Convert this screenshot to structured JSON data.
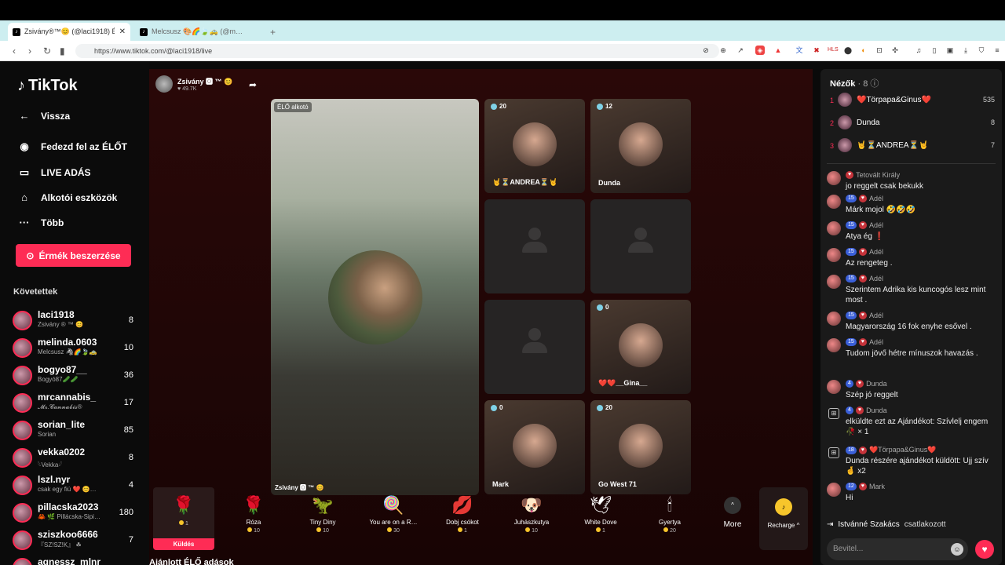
{
  "browser": {
    "tabs": [
      {
        "label": "Zsivány®™😊 (@laci1918) Él…",
        "close": "✕"
      },
      {
        "label": "Melcsusz 🎨🌈🍃🚕 (@m…",
        "close": ""
      }
    ],
    "new_tab": "+",
    "url": "https://www.tiktok.com/@laci1918/live"
  },
  "sidebar": {
    "logo": "TikTok",
    "menu": [
      {
        "label": "Vissza",
        "icon": "←"
      },
      {
        "label": "Fedezd fel az ÉLŐT",
        "icon": "◉"
      },
      {
        "label": "LIVE ADÁS",
        "icon": "▭"
      },
      {
        "label": "Alkotói eszközök",
        "icon": "⌂"
      },
      {
        "label": "Több",
        "icon": "···"
      }
    ],
    "coins_button": "Érmék beszerzése",
    "following_title": "Követettek",
    "following": [
      {
        "name": "laci1918",
        "sub": "Zsivány ® ™ 😊",
        "count": "8"
      },
      {
        "name": "melinda.0603",
        "sub": "Melcsusz 🦓🌈🍃🚕",
        "count": "10"
      },
      {
        "name": "bogyo87__",
        "sub": "Bogyó87🥒🥒",
        "count": "36"
      },
      {
        "name": "mrcannabis_",
        "sub": "𝓜𝓻.𝓒𝓪𝓷𝓷𝓪𝓫𝓲𝓼®",
        "count": "17"
      },
      {
        "name": "sorian_lite",
        "sub": "Sorian",
        "count": "85"
      },
      {
        "name": "vekka0202",
        "sub": "𓆩Vekka𓆪",
        "count": "8"
      },
      {
        "name": "lszl.nyr",
        "sub": "csak egy fiú ❤️ 😊…",
        "count": "4"
      },
      {
        "name": "pillacska2023",
        "sub": "🦀 🌿 Pillácska-Sipi…",
        "count": "180"
      },
      {
        "name": "sziszkoo6666",
        "sub": "『SZ!SZ!K』 ☘",
        "count": "7"
      },
      {
        "name": "agnessz_mlnr",
        "sub": "",
        "count": ""
      }
    ]
  },
  "stage": {
    "host_name": "Zsivány 🅾 ™ 😊",
    "host_likes": "♥ 49.7K",
    "main_tag": "ÉLŐ alkotó",
    "main_caption": "Zsivány 🅾 ™ 😊",
    "cells": [
      {
        "count": "20",
        "name": "🤘⏳ANDREA⏳🤘"
      },
      {
        "count": "12",
        "name": "Dunda"
      },
      {
        "count": "",
        "name": ""
      },
      {
        "count": "",
        "name": ""
      },
      {
        "count": "",
        "name": ""
      },
      {
        "count": "0",
        "name": "❤️❤️__Gina__"
      },
      {
        "count": "0",
        "name": "Mark"
      },
      {
        "count": "20",
        "name": "Go West 71"
      }
    ]
  },
  "gifts": {
    "items": [
      {
        "name": "",
        "price": "1",
        "icon": "🌹",
        "action": "Küldés"
      },
      {
        "name": "Róza",
        "price": "10",
        "icon": "🌹"
      },
      {
        "name": "Tiny Diny",
        "price": "10",
        "icon": "🦖"
      },
      {
        "name": "You are on a R…",
        "price": "30",
        "icon": "🍭"
      },
      {
        "name": "Dobj csókot",
        "price": "1",
        "icon": "💋"
      },
      {
        "name": "Juhászkutya",
        "price": "10",
        "icon": "🐶"
      },
      {
        "name": "White Dove",
        "price": "1",
        "icon": "🕊"
      },
      {
        "name": "Gyertya",
        "price": "20",
        "icon": "🕯"
      }
    ],
    "more": "More",
    "more_icon": "^",
    "recharge": "Recharge ^"
  },
  "recent_title": "Ajánlott ÉLŐ adások",
  "chat": {
    "title": "Nézők",
    "viewer_count": "· 8",
    "ranking": [
      {
        "rank": "1",
        "name": "❤️Törpapa&Ginus❤️",
        "value": "535"
      },
      {
        "rank": "2",
        "name": "Dunda",
        "value": "8"
      },
      {
        "rank": "3",
        "name": "🤘⏳ANDREA⏳🤘",
        "value": "7"
      }
    ],
    "messages": [
      {
        "user": "Tetovált Király",
        "level": "",
        "text": "jo reggelt csak bekukk"
      },
      {
        "user": "Adél",
        "level": "15",
        "text": "Márk mojol 🤣🤣🤣"
      },
      {
        "user": "Adél",
        "level": "15",
        "text": "Atya ég ❗"
      },
      {
        "user": "Adél",
        "level": "15",
        "text": "Az rengeteg ."
      },
      {
        "user": "Adél",
        "level": "15",
        "text": "Szerintem Adrika kis kuncogós lesz mint most ."
      },
      {
        "user": "Adél",
        "level": "15",
        "text": "Magyarország 16 fok enyhe esővel ."
      },
      {
        "user": "Adél",
        "level": "15",
        "text": "Tudom jövő hétre mínuszok havazás ."
      },
      {
        "user": "Dunda",
        "level": "4",
        "text": "Szép jó reggelt"
      },
      {
        "user": "Dunda",
        "level": "4",
        "text": "elküldte ezt az Ajándékot: Szívlelj engem 🥀 × 1"
      },
      {
        "user": "❤️Törpapa&Ginus❤️",
        "level": "18",
        "text": "Dunda részére ajándékot küldött: Ujj szív 🤞 x2"
      },
      {
        "user": "Mark",
        "level": "12",
        "text": "Hi"
      }
    ],
    "joined_user": "Istvánné Szakács",
    "joined_text": "csatlakozott",
    "input_placeholder": "Bevitel..."
  }
}
